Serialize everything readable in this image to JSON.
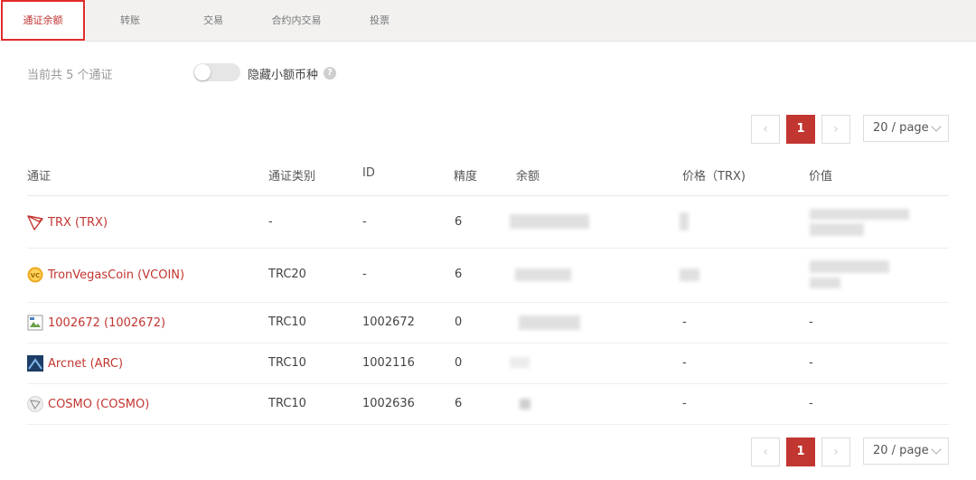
{
  "tabs": [
    {
      "label": "通证余额",
      "active": true
    },
    {
      "label": "转账",
      "active": false
    },
    {
      "label": "交易",
      "active": false
    },
    {
      "label": "合约内交易",
      "active": false
    },
    {
      "label": "投票",
      "active": false
    }
  ],
  "summary": "当前共 5 个通证",
  "toggle": {
    "label": "隐藏小额币种",
    "on": false
  },
  "help_icon": "?",
  "pagination": {
    "prev": "‹",
    "current": "1",
    "next": "›",
    "page_size": "20 / page"
  },
  "columns": [
    "通证",
    "通证类别",
    "ID",
    "精度",
    "余额",
    "价格（TRX)",
    "价值"
  ],
  "rows": [
    {
      "icon": "trx-logo-icon",
      "token": "TRX (TRX)",
      "type": "-",
      "id": "-",
      "precision": "6",
      "price": "",
      "value": ""
    },
    {
      "icon": "vcoin-logo-icon",
      "token": "TronVegasCoin (VCOIN)",
      "type": "TRC20",
      "id": "-",
      "precision": "6",
      "price": "",
      "value": ""
    },
    {
      "icon": "broken-image-icon",
      "token": "1002672 (1002672)",
      "type": "TRC10",
      "id": "1002672",
      "precision": "0",
      "price": "-",
      "value": "-"
    },
    {
      "icon": "arcnet-logo-icon",
      "token": "Arcnet (ARC)",
      "type": "TRC10",
      "id": "1002116",
      "precision": "0",
      "price": "-",
      "value": "-"
    },
    {
      "icon": "cosmo-logo-icon",
      "token": "COSMO (COSMO)",
      "type": "TRC10",
      "id": "1002636",
      "precision": "6",
      "price": "-",
      "value": "-"
    }
  ],
  "colors": {
    "accent": "#c23631",
    "highlight": "#e02b2b"
  }
}
